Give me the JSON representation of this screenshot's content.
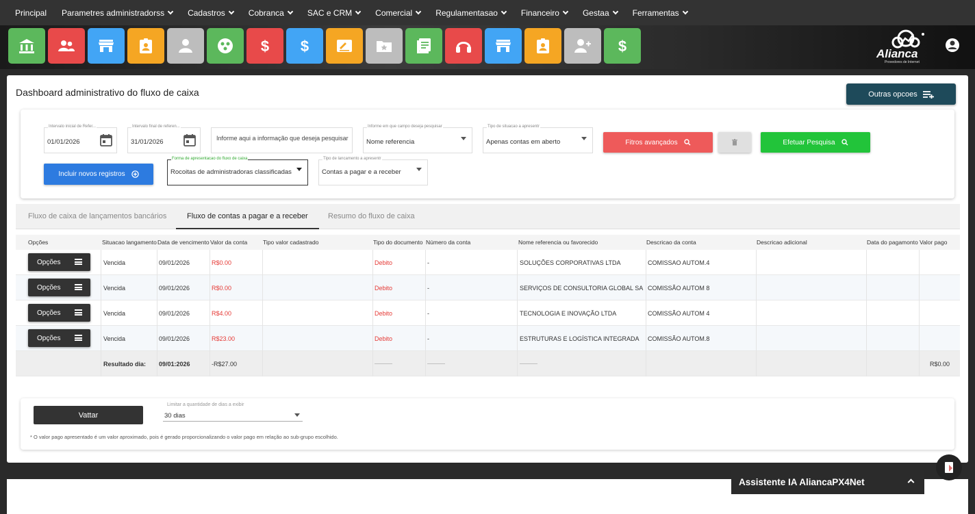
{
  "nav": {
    "items": [
      {
        "label": "Principal",
        "dropdown": false
      },
      {
        "label": "Parametres administradorss",
        "dropdown": true
      },
      {
        "label": "Cadastros",
        "dropdown": true
      },
      {
        "label": "Cobranca",
        "dropdown": true
      },
      {
        "label": "SAC e CRM",
        "dropdown": true
      },
      {
        "label": "Comercial",
        "dropdown": true
      },
      {
        "label": "Regulamentasao",
        "dropdown": true
      },
      {
        "label": "Financeiro",
        "dropdown": true
      },
      {
        "label": "Gestaa",
        "dropdown": true
      },
      {
        "label": "Ferramentas",
        "dropdown": true
      }
    ]
  },
  "iconbar": {
    "tiles": [
      {
        "icon": "bank-icon",
        "color": "#5cb85c"
      },
      {
        "icon": "users-icon",
        "color": "#e84a4a"
      },
      {
        "icon": "store-icon",
        "color": "#42a5f5"
      },
      {
        "icon": "badge-icon",
        "color": "#f5a623"
      },
      {
        "icon": "person-icon",
        "color": "#bdbdbd"
      },
      {
        "icon": "group-circle-icon",
        "color": "#5cb85c"
      },
      {
        "icon": "dollar-icon",
        "color": "#e84a4a"
      },
      {
        "icon": "dollar-icon",
        "color": "#42a5f5"
      },
      {
        "icon": "signature-icon",
        "color": "#f5a623"
      },
      {
        "icon": "folder-star-icon",
        "color": "#bdbdbd"
      },
      {
        "icon": "notes-icon",
        "color": "#5cb85c"
      },
      {
        "icon": "headset-icon",
        "color": "#e84a4a"
      },
      {
        "icon": "store-icon",
        "color": "#42a5f5"
      },
      {
        "icon": "badge-icon",
        "color": "#f5a623"
      },
      {
        "icon": "add-user-icon",
        "color": "#bdbdbd"
      },
      {
        "icon": "dollar-icon",
        "color": "#5cb85c"
      }
    ],
    "logo_text": "Alianca",
    "logo_tagline": "Provedores de Internet"
  },
  "page": {
    "title": "Dashboard administrativo do fluxo de caixa",
    "outras_label": "Outras opcoes"
  },
  "filters": {
    "start_label": "Intervalo inicial de Refer...",
    "start_value": "01/01/2026",
    "end_label": "Intervalo final de referen...",
    "end_value": "31/01/2026",
    "search_placeholder": "Informe aqui a informação que deseja pesquisar",
    "campo_label": "Informe em que campo deseja pesquisar",
    "campo_value": "Nome referencia",
    "situacao_label": "Tipo de situacao a apresentr",
    "situacao_value": "Apenas contas em aberto",
    "filtros_label": "Fitros avançados",
    "pesquisa_label": "Efetuar Pesquisa",
    "incluir_label": "Incluir novos registros",
    "forma_label": "Forma de apresentacao do fluxo de caixa",
    "forma_value": "Rocoitas de administradoras classificadas",
    "tipo_label": "Tipo de lancamento a apresentr",
    "tipo_value": "Contas a pagar e a receber"
  },
  "tabs": [
    {
      "label": "Fluxo de caixa de lançamentos bancários",
      "active": false
    },
    {
      "label": "Fluxo de contas a pagar e a receber",
      "active": true
    },
    {
      "label": "Resumo do fluxo de caixa",
      "active": false
    }
  ],
  "table": {
    "headers": [
      "Opções",
      "Situacao langamento",
      "Data de vencimento",
      "Valor da conta",
      "Tipo valor cadastrado",
      "Tipo do documento",
      "Número da conta",
      "Nome referencia ou favorecido",
      "Descricao da conta",
      "Descricao adicional",
      "Data do pagamonto",
      "Valor pago"
    ],
    "option_label": "Opções",
    "rows": [
      {
        "situacao": "Vencida",
        "vencimento": "09/01/2026",
        "valor": "R$0.00",
        "tipo_valor": "",
        "tipo_doc": "Debito",
        "numero": "-",
        "nome": "SOLUÇÕES CORPORATIVAS LTDA",
        "descricao": "COMISSAO AUTOM.4",
        "adicional": "",
        "data_pag": "",
        "valor_pago": ""
      },
      {
        "situacao": "Vencida",
        "vencimento": "09/01/2026",
        "valor": "R$0.00",
        "tipo_valor": "",
        "tipo_doc": "Debito",
        "numero": "-",
        "nome": "SERVIÇOS DE CONSULTORIA GLOBAL SA",
        "descricao": "COMISSÃO AUTOM 8",
        "adicional": "",
        "data_pag": "",
        "valor_pago": ""
      },
      {
        "situacao": "Vencida",
        "vencimento": "09/01/2026",
        "valor": "R$4.00",
        "tipo_valor": "",
        "tipo_doc": "Debito",
        "numero": "-",
        "nome": "TECNOLOGIA E INOVAÇÃO LTDA",
        "descricao": "COMISSÃO AUTOM 4",
        "adicional": "",
        "data_pag": "",
        "valor_pago": ""
      },
      {
        "situacao": "Vencida",
        "vencimento": "09/01/2026",
        "valor": "R$23.00",
        "tipo_valor": "",
        "tipo_doc": "Debito",
        "numero": "-",
        "nome": "ESTRUTURAS E LOGÍSTICA INTEGRADA",
        "descricao": "COMISSÃO AUTOM.8",
        "adicional": "",
        "data_pag": "",
        "valor_pago": ""
      }
    ],
    "total": {
      "label": "Resultado dia:",
      "date": "09/01:2026",
      "valor": "-R$27.00",
      "dash1": "-------------",
      "dash2": "-------------",
      "dash3": "-------------",
      "valor_pago": "R$0.00"
    }
  },
  "bottom": {
    "voltar_label": "Vattar",
    "dias_label": "Limitar a quantidade de dias a exibir",
    "dias_value": "30 dias",
    "footnote": "* O valor pago apresentado é um valor aproximado, pois é gerado proporcionalizando o valor pago em relação ao sub-grupo escolhido."
  },
  "assistant": {
    "label": "Assistente IA AliancaPX4Net"
  }
}
